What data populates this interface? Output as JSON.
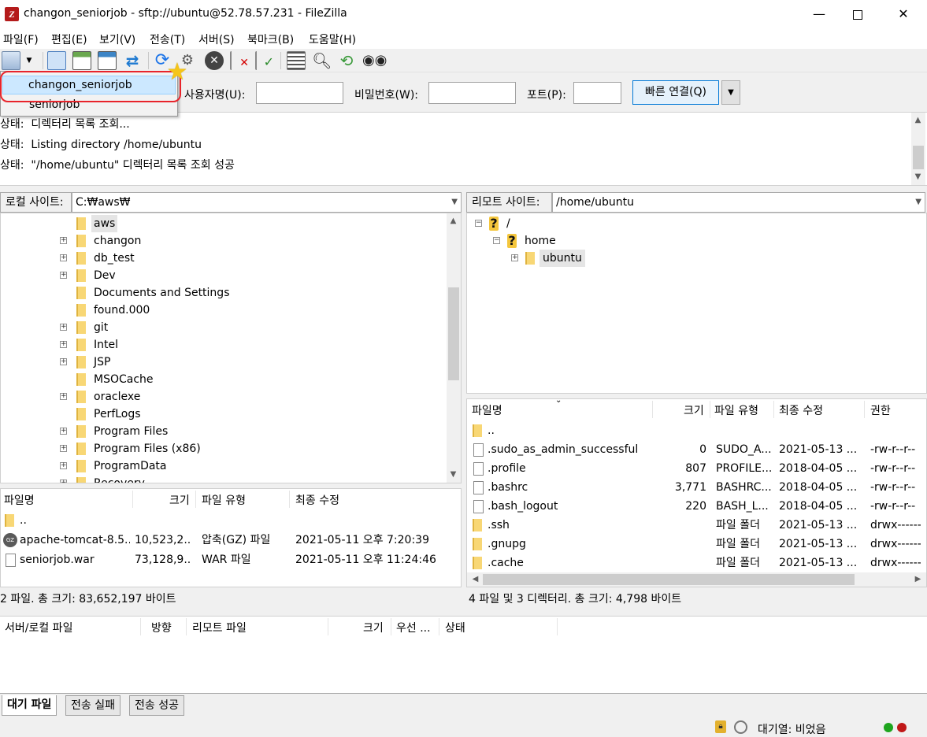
{
  "window": {
    "title": "changon_seniorjob - sftp://ubuntu@52.78.57.231 - FileZilla",
    "logo_letter": "Z",
    "min_glyph": "—",
    "close_glyph": "✕"
  },
  "menu": [
    "파일(F)",
    "편집(E)",
    "보기(V)",
    "전송(T)",
    "서버(S)",
    "북마크(B)",
    "도움말(H)"
  ],
  "toolbar": {
    "icons": [
      "site-manager-icon",
      "dropdown-arrow-icon",
      "toggle-message-log-icon",
      "toggle-local-tree-icon",
      "toggle-remote-tree-icon",
      "toggle-queue-icon",
      "refresh-icon",
      "process-queue-icon",
      "cancel-icon",
      "disconnect-icon",
      "reconnect-icon",
      "directory-filter-icon",
      "compare-icon",
      "sync-browse-icon",
      "search-icon"
    ]
  },
  "site_dropdown": {
    "items": [
      "changon_seniorjob",
      "seniorjob"
    ],
    "selected": "changon_seniorjob"
  },
  "quickconnect": {
    "username_label": "사용자명(U):",
    "password_label": "비밀번호(W):",
    "port_label": "포트(P):",
    "username_value": "",
    "password_value": "",
    "port_value": "",
    "connect_button": "빠른 연결(Q)",
    "dropdown_glyph": "▼"
  },
  "log": [
    {
      "label": "상태:",
      "text": "디렉터리 목록 조회..."
    },
    {
      "label": "상태:",
      "text": "Listing directory /home/ubuntu"
    },
    {
      "label": "상태:",
      "text": "\"/home/ubuntu\" 디렉터리 목록 조회 성공"
    }
  ],
  "local": {
    "site_label": "로컬 사이트:",
    "path": "C:₩aws₩",
    "tree": [
      {
        "name": "aws",
        "expander": false,
        "selected": true
      },
      {
        "name": "changon",
        "expander": true
      },
      {
        "name": "db_test",
        "expander": true
      },
      {
        "name": "Dev",
        "expander": true
      },
      {
        "name": "Documents and Settings",
        "expander": false
      },
      {
        "name": "found.000",
        "expander": false
      },
      {
        "name": "git",
        "expander": true
      },
      {
        "name": "Intel",
        "expander": true
      },
      {
        "name": "JSP",
        "expander": true
      },
      {
        "name": "MSOCache",
        "expander": false
      },
      {
        "name": "oraclexe",
        "expander": true
      },
      {
        "name": "PerfLogs",
        "expander": false
      },
      {
        "name": "Program Files",
        "expander": true
      },
      {
        "name": "Program Files (x86)",
        "expander": true
      },
      {
        "name": "ProgramData",
        "expander": true
      },
      {
        "name": "Recovery",
        "expander": true
      }
    ],
    "columns": [
      "파일명",
      "크기",
      "파일 유형",
      "최종 수정"
    ],
    "files": [
      {
        "name": "..",
        "size": "",
        "type": "",
        "modified": "",
        "icon": "folder"
      },
      {
        "name": "apache-tomcat-8.5....",
        "size": "10,523,2...",
        "type": "압축(GZ) 파일",
        "modified": "2021-05-11 오후 7:20:39",
        "icon": "gz"
      },
      {
        "name": "seniorjob.war",
        "size": "73,128,9...",
        "type": "WAR 파일",
        "modified": "2021-05-11 오후 11:24:46",
        "icon": "file"
      }
    ],
    "status": "2 파일. 총 크기: 83,652,197 바이트"
  },
  "remote": {
    "site_label": "리모트 사이트:",
    "path": "/home/ubuntu",
    "tree": [
      {
        "name": "/",
        "level": 0,
        "icon": "question"
      },
      {
        "name": "home",
        "level": 1,
        "icon": "question"
      },
      {
        "name": "ubuntu",
        "level": 2,
        "icon": "folder",
        "selected": true
      }
    ],
    "columns": [
      "파일명",
      "크기",
      "파일 유형",
      "최종 수정",
      "권한"
    ],
    "files": [
      {
        "name": "..",
        "size": "",
        "type": "",
        "modified": "",
        "perm": "",
        "icon": "folder"
      },
      {
        "name": ".sudo_as_admin_successful",
        "size": "0",
        "type": "SUDO_A...",
        "modified": "2021-05-13 ...",
        "perm": "-rw-r--r--",
        "icon": "file"
      },
      {
        "name": ".profile",
        "size": "807",
        "type": "PROFILE...",
        "modified": "2018-04-05 ...",
        "perm": "-rw-r--r--",
        "icon": "file"
      },
      {
        "name": ".bashrc",
        "size": "3,771",
        "type": "BASHRC...",
        "modified": "2018-04-05 ...",
        "perm": "-rw-r--r--",
        "icon": "file"
      },
      {
        "name": ".bash_logout",
        "size": "220",
        "type": "BASH_L...",
        "modified": "2018-04-05 ...",
        "perm": "-rw-r--r--",
        "icon": "file"
      },
      {
        "name": ".ssh",
        "size": "",
        "type": "파일 폴더",
        "modified": "2021-05-13 ...",
        "perm": "drwx------",
        "icon": "folder"
      },
      {
        "name": ".gnupg",
        "size": "",
        "type": "파일 폴더",
        "modified": "2021-05-13 ...",
        "perm": "drwx------",
        "icon": "folder"
      },
      {
        "name": ".cache",
        "size": "",
        "type": "파일 폴더",
        "modified": "2021-05-13 ...",
        "perm": "drwx------",
        "icon": "folder"
      }
    ],
    "status": "4 파일 및 3 디렉터리. 총 크기: 4,798 바이트"
  },
  "queue": {
    "columns": [
      "서버/로컬 파일",
      "방향",
      "리모트 파일",
      "크기",
      "우선 ...",
      "상태"
    ],
    "tabs": [
      "대기 파일",
      "전송 실패",
      "전송 성공"
    ],
    "active_tab": "대기 파일",
    "status": "대기열: 비었음"
  },
  "colors": {
    "accent": "#0078d7",
    "highlight_ring": "#e8242b",
    "selection": "#cce8ff",
    "led_green": "#1ea51e",
    "led_red": "#c01818"
  }
}
